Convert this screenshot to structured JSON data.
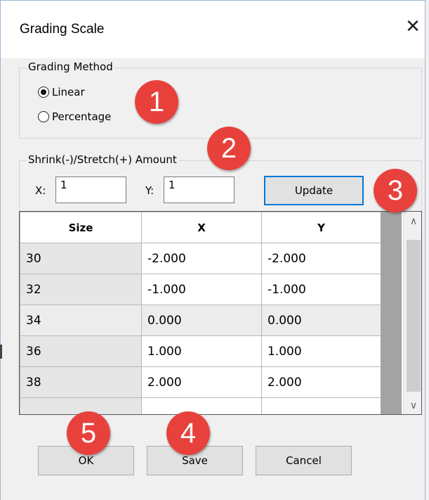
{
  "window": {
    "title": "Grading Scale",
    "close_glyph": "✕"
  },
  "grading_method": {
    "label": "Grading Method",
    "options": [
      {
        "label": "Linear",
        "selected": true
      },
      {
        "label": "Percentage",
        "selected": false
      }
    ]
  },
  "amount": {
    "label": "Shrink(-)/Stretch(+) Amount",
    "x_label": "X:",
    "x_value": "1",
    "y_label": "Y:",
    "y_value": "1",
    "update_label": "Update"
  },
  "table": {
    "headers": [
      "Size",
      "X",
      "Y"
    ],
    "rows": [
      [
        "30",
        "-2.000",
        "-2.000"
      ],
      [
        "32",
        "-1.000",
        "-1.000"
      ],
      [
        "34",
        "0.000",
        "0.000"
      ],
      [
        "36",
        "1.000",
        "1.000"
      ],
      [
        "38",
        "2.000",
        "2.000"
      ]
    ]
  },
  "buttons": {
    "ok": "OK",
    "save": "Save",
    "cancel": "Cancel"
  },
  "badges": [
    "1",
    "2",
    "3",
    "4",
    "5"
  ],
  "colors": {
    "badge": "#e8413c",
    "default_button_border": "#0078d7"
  }
}
